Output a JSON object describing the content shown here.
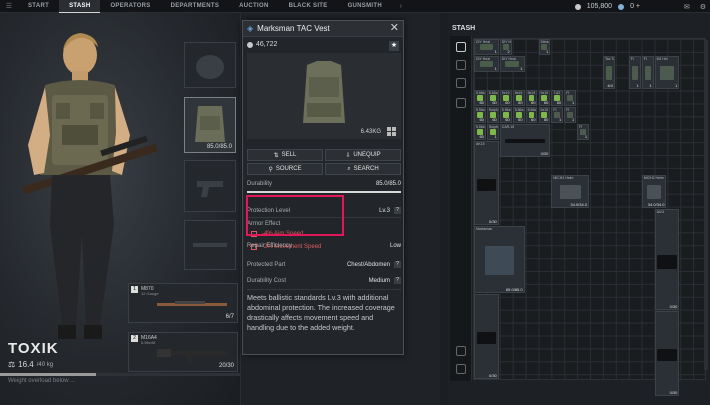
{
  "nav": {
    "tabs": [
      "START",
      "STASH",
      "OPERATORS",
      "DEPARTMENTS",
      "AUCTION",
      "BLACK SITE",
      "GUNSMITH"
    ],
    "active_tab": "STASH",
    "currency_1": "105,800",
    "currency_2": "0 +"
  },
  "character": {
    "name": "TOXIK",
    "weight": "16.4",
    "weight_unit": "/40 kg",
    "warning": "Weight overload below ..."
  },
  "loadout": {
    "vest_durability": "85.0/85.0",
    "weapon1": {
      "num": "1",
      "name": "M870",
      "sub": "12 Gauge",
      "ammo": "6/7"
    },
    "weapon2": {
      "num": "2",
      "name": "M16A4",
      "sub": "5.56x45",
      "ammo": "20/30"
    }
  },
  "popup": {
    "title": "Marksman TAC Vest",
    "price": "46,722",
    "weight": "6.43KG",
    "buttons": {
      "sell": "SELL",
      "unequip": "UNEQUIP",
      "source": "SOURCE",
      "search": "SEARCH"
    },
    "durability_label": "Durability",
    "durability_value": "85.0/85.0",
    "protection_level_label": "Protection Level",
    "protection_level_value": "Lv.3",
    "armor_effect_label": "Armor Effect",
    "effect_1": "-4% Aim Speed",
    "effect_2": "-2% Movement Speed",
    "repair_label": "Repair Efficiency",
    "repair_value": "Low",
    "protected_part_label": "Protected Part",
    "protected_part_value": "Chest/Abdomen",
    "durability_cost_label": "Durability Cost",
    "durability_cost_value": "Medium",
    "description": "Meets ballistic standards Lv.3 with additional abdominal protection. The increased coverage drastically affects movement speed and handling due to the added weight."
  },
  "stash": {
    "title": "STASH",
    "items": [
      {
        "label": "DIY Heal",
        "count": "1"
      },
      {
        "label": "DIY Heal",
        "count": "2"
      },
      {
        "label": "Stimulant",
        "count": "1"
      },
      {
        "label": "DIY Heal",
        "count": "1"
      },
      {
        "label": "DIY Heal",
        "count": "1"
      },
      {
        "label": "Tac TA",
        "count": "4/4"
      },
      {
        "label": "FI",
        "count": "1"
      },
      {
        "label": "FI",
        "count": "1"
      },
      {
        "label": "M1 Hel",
        "count": "1"
      },
      {
        "label": "5.56x45",
        "count": "60"
      },
      {
        "label": "5.56x45",
        "count": "60"
      },
      {
        "label": "9x19",
        "count": "60"
      },
      {
        "label": "9x19",
        "count": "60"
      },
      {
        "label": "9x19",
        "count": "60"
      },
      {
        "label": "9x19",
        "count": "60"
      },
      {
        "label": "7.62",
        "count": "60"
      },
      {
        "label": "FI",
        "count": "1"
      },
      {
        "label": "5.56x45",
        "count": "60"
      },
      {
        "label": "Sulphur",
        "count": "60"
      },
      {
        "label": "5.56x45",
        "count": "60"
      },
      {
        "label": "5.56x45",
        "count": "60"
      },
      {
        "label": "5.56x45",
        "count": "60"
      },
      {
        "label": "9x19",
        "count": "60"
      },
      {
        "label": "FI",
        "count": "1"
      },
      {
        "label": "FI",
        "count": "1"
      },
      {
        "label": "5.56x45",
        "count": "60"
      },
      {
        "label": "Sulphur",
        "count": "1"
      },
      {
        "label": "CAR-15",
        "count": "0/30"
      },
      {
        "label": "FI",
        "count": "1"
      },
      {
        "label": "AK15",
        "count": "0/30"
      },
      {
        "label": "MICH2 Helm",
        "count": "34.0/34.0"
      },
      {
        "label": "MICH2 Helm",
        "count": "34.0/34.0"
      },
      {
        "label": "AUG",
        "count": "0/30"
      },
      {
        "label": "Marksman",
        "count": "85.0/85.0"
      },
      {
        "label": "",
        "count": "0/30"
      },
      {
        "label": "",
        "count": "0/30"
      }
    ]
  },
  "colors": {
    "highlight": "#e0185a",
    "negative_effect": "#e05a5a",
    "ammo_green": "#7fb84a",
    "medical_red": "#c94848"
  },
  "icons": [
    "currency-icon",
    "close-icon",
    "star-icon",
    "sell-icon",
    "unequip-icon",
    "source-icon",
    "search-icon",
    "grid-icon",
    "weight-icon"
  ]
}
